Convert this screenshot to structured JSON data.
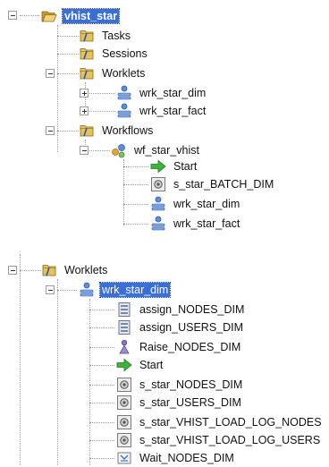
{
  "tree1": {
    "root": "vhist_star",
    "tasks": "Tasks",
    "sessions": "Sessions",
    "worklets": "Worklets",
    "worklet_items": [
      "wrk_star_dim",
      "wrk_star_fact"
    ],
    "workflows": "Workflows",
    "workflow_name": "wf_star_vhist",
    "workflow_items": [
      "Start",
      "s_star_BATCH_DIM",
      "wrk_star_dim",
      "wrk_star_fact"
    ]
  },
  "tree2": {
    "worklets": "Worklets",
    "selected_worklet": "wrk_star_dim",
    "items": [
      "assign_NODES_DIM",
      "assign_USERS_DIM",
      "Raise_NODES_DIM",
      "Start",
      "s_star_NODES_DIM",
      "s_star_USERS_DIM",
      "s_star_VHIST_LOAD_LOG_NODES",
      "s_star_VHIST_LOAD_LOG_USERS",
      "Wait_NODES_DIM"
    ]
  },
  "colors": {
    "selection": "#3a6fd8",
    "folder": "#d9b24a",
    "start_arrow": "#33a02c",
    "worklet": "#4a7fd0"
  }
}
